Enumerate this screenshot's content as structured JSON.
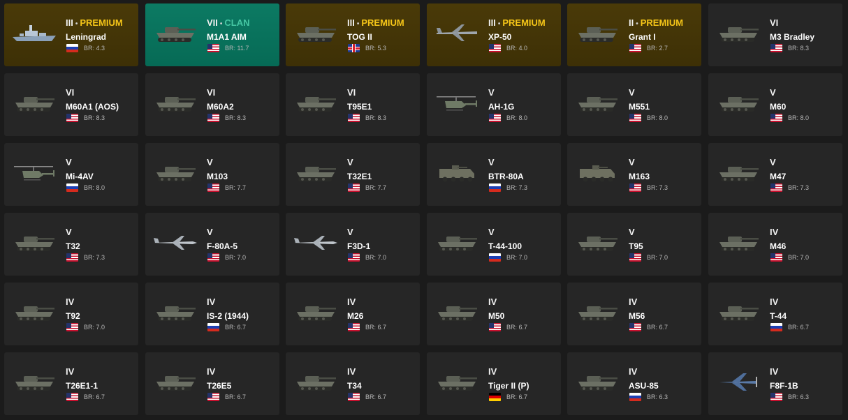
{
  "vehicles": [
    {
      "tier": "III",
      "tag": "PREMIUM",
      "name": "Leningrad",
      "br": "BR: 4.3",
      "nation": "ussr",
      "kind": "ship",
      "highlight": "premium"
    },
    {
      "tier": "VII",
      "tag": "CLAN",
      "name": "M1A1 AIM",
      "br": "BR: 11.7",
      "nation": "usa",
      "kind": "tank",
      "highlight": "clan"
    },
    {
      "tier": "III",
      "tag": "PREMIUM",
      "name": "TOG II",
      "br": "BR: 5.3",
      "nation": "uk",
      "kind": "tank",
      "highlight": "premium"
    },
    {
      "tier": "III",
      "tag": "PREMIUM",
      "name": "XP-50",
      "br": "BR: 4.0",
      "nation": "usa",
      "kind": "plane",
      "highlight": "premium"
    },
    {
      "tier": "II",
      "tag": "PREMIUM",
      "name": "Grant I",
      "br": "BR: 2.7",
      "nation": "usa",
      "kind": "tank",
      "highlight": "premium"
    },
    {
      "tier": "VI",
      "tag": "",
      "name": "M3 Bradley",
      "br": "BR: 8.3",
      "nation": "usa",
      "kind": "tank",
      "highlight": "none"
    },
    {
      "tier": "VI",
      "tag": "",
      "name": "M60A1 (AOS)",
      "br": "BR: 8.3",
      "nation": "usa",
      "kind": "tank",
      "highlight": "none"
    },
    {
      "tier": "VI",
      "tag": "",
      "name": "M60A2",
      "br": "BR: 8.3",
      "nation": "usa",
      "kind": "tank",
      "highlight": "none"
    },
    {
      "tier": "VI",
      "tag": "",
      "name": "T95E1",
      "br": "BR: 8.3",
      "nation": "usa",
      "kind": "tank",
      "highlight": "none"
    },
    {
      "tier": "V",
      "tag": "",
      "name": "AH-1G",
      "br": "BR: 8.0",
      "nation": "usa",
      "kind": "heli",
      "highlight": "none"
    },
    {
      "tier": "V",
      "tag": "",
      "name": "M551",
      "br": "BR: 8.0",
      "nation": "usa",
      "kind": "tank",
      "highlight": "none"
    },
    {
      "tier": "V",
      "tag": "",
      "name": "M60",
      "br": "BR: 8.0",
      "nation": "usa",
      "kind": "tank",
      "highlight": "none"
    },
    {
      "tier": "V",
      "tag": "",
      "name": "Mi-4AV",
      "br": "BR: 8.0",
      "nation": "ussr",
      "kind": "heli",
      "highlight": "none"
    },
    {
      "tier": "V",
      "tag": "",
      "name": "M103",
      "br": "BR: 7.7",
      "nation": "usa",
      "kind": "tank",
      "highlight": "none"
    },
    {
      "tier": "V",
      "tag": "",
      "name": "T32E1",
      "br": "BR: 7.7",
      "nation": "usa",
      "kind": "tank",
      "highlight": "none"
    },
    {
      "tier": "V",
      "tag": "",
      "name": "BTR-80A",
      "br": "BR: 7.3",
      "nation": "ussr",
      "kind": "apc",
      "highlight": "none"
    },
    {
      "tier": "V",
      "tag": "",
      "name": "M163",
      "br": "BR: 7.3",
      "nation": "usa",
      "kind": "apc",
      "highlight": "none"
    },
    {
      "tier": "V",
      "tag": "",
      "name": "M47",
      "br": "BR: 7.3",
      "nation": "usa",
      "kind": "tank",
      "highlight": "none"
    },
    {
      "tier": "V",
      "tag": "",
      "name": "T32",
      "br": "BR: 7.3",
      "nation": "usa",
      "kind": "tank",
      "highlight": "none"
    },
    {
      "tier": "V",
      "tag": "",
      "name": "F-80A-5",
      "br": "BR: 7.0",
      "nation": "usa",
      "kind": "jet",
      "highlight": "none"
    },
    {
      "tier": "V",
      "tag": "",
      "name": "F3D-1",
      "br": "BR: 7.0",
      "nation": "usa",
      "kind": "jet",
      "highlight": "none"
    },
    {
      "tier": "V",
      "tag": "",
      "name": "T-44-100",
      "br": "BR: 7.0",
      "nation": "ussr",
      "kind": "tank",
      "highlight": "none"
    },
    {
      "tier": "V",
      "tag": "",
      "name": "T95",
      "br": "BR: 7.0",
      "nation": "usa",
      "kind": "tank",
      "highlight": "none"
    },
    {
      "tier": "IV",
      "tag": "",
      "name": "M46",
      "br": "BR: 7.0",
      "nation": "usa",
      "kind": "tank",
      "highlight": "none"
    },
    {
      "tier": "IV",
      "tag": "",
      "name": "T92",
      "br": "BR: 7.0",
      "nation": "usa",
      "kind": "tank",
      "highlight": "none"
    },
    {
      "tier": "IV",
      "tag": "",
      "name": "IS-2 (1944)",
      "br": "BR: 6.7",
      "nation": "ussr",
      "kind": "tank",
      "highlight": "none"
    },
    {
      "tier": "IV",
      "tag": "",
      "name": "M26",
      "br": "BR: 6.7",
      "nation": "usa",
      "kind": "tank",
      "highlight": "none"
    },
    {
      "tier": "IV",
      "tag": "",
      "name": "M50",
      "br": "BR: 6.7",
      "nation": "usa",
      "kind": "tank",
      "highlight": "none"
    },
    {
      "tier": "IV",
      "tag": "",
      "name": "M56",
      "br": "BR: 6.7",
      "nation": "usa",
      "kind": "tank",
      "highlight": "none"
    },
    {
      "tier": "IV",
      "tag": "",
      "name": "T-44",
      "br": "BR: 6.7",
      "nation": "ussr",
      "kind": "tank",
      "highlight": "none"
    },
    {
      "tier": "IV",
      "tag": "",
      "name": "T26E1-1",
      "br": "BR: 6.7",
      "nation": "usa",
      "kind": "tank",
      "highlight": "none"
    },
    {
      "tier": "IV",
      "tag": "",
      "name": "T26E5",
      "br": "BR: 6.7",
      "nation": "usa",
      "kind": "tank",
      "highlight": "none"
    },
    {
      "tier": "IV",
      "tag": "",
      "name": "T34",
      "br": "BR: 6.7",
      "nation": "usa",
      "kind": "tank",
      "highlight": "none"
    },
    {
      "tier": "IV",
      "tag": "",
      "name": "Tiger II (P)",
      "br": "BR: 6.7",
      "nation": "germany",
      "kind": "tank",
      "highlight": "none"
    },
    {
      "tier": "IV",
      "tag": "",
      "name": "ASU-85",
      "br": "BR: 6.3",
      "nation": "ussr",
      "kind": "tank",
      "highlight": "none"
    },
    {
      "tier": "IV",
      "tag": "",
      "name": "F8F-1B",
      "br": "BR: 6.3",
      "nation": "usa",
      "kind": "prop",
      "highlight": "none"
    }
  ],
  "colors": {
    "premium_tag": "#f5c518",
    "clan_tag": "#46c7a3",
    "card_bg": "#262626",
    "page_bg": "#1b1b1b"
  }
}
